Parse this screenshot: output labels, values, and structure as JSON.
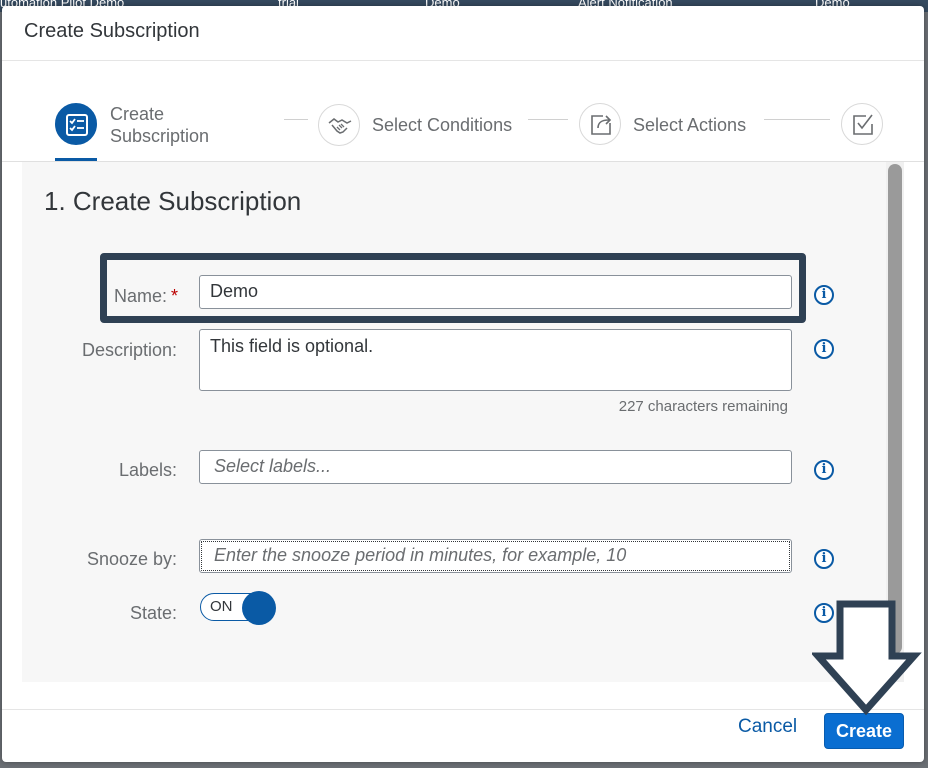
{
  "background_bar": {
    "items": [
      "utomation Pilot Demo",
      "trial",
      "Demo",
      "Alert Notification",
      "Demo"
    ]
  },
  "dialog": {
    "title": "Create Subscription"
  },
  "wizard": {
    "steps": [
      {
        "label_line1": "Create",
        "label_line2": "Subscription",
        "icon": "checklist-icon",
        "active": true
      },
      {
        "label": "Select Conditions",
        "icon": "handshake-icon",
        "active": false
      },
      {
        "label": "Select Actions",
        "icon": "share-icon",
        "active": false
      },
      {
        "label": "",
        "icon": "checkbox-icon",
        "active": false
      }
    ]
  },
  "form": {
    "section_title": "1. Create Subscription",
    "name": {
      "label": "Name:",
      "required_marker": "*",
      "value": "Demo"
    },
    "description": {
      "label": "Description:",
      "value": "This field is optional.",
      "counter": "227 characters remaining"
    },
    "labels": {
      "label": "Labels:",
      "placeholder": "Select labels..."
    },
    "snooze": {
      "label": "Snooze by:",
      "placeholder": "Enter the snooze period in minutes, for example, 10"
    },
    "state": {
      "label": "State:",
      "switch_text": "ON",
      "on": true
    }
  },
  "footer": {
    "cancel_label": "Cancel",
    "create_label": "Create"
  },
  "colors": {
    "accent": "#0a5aa5",
    "button": "#0a6ed1",
    "annotation": "#2f4154"
  }
}
